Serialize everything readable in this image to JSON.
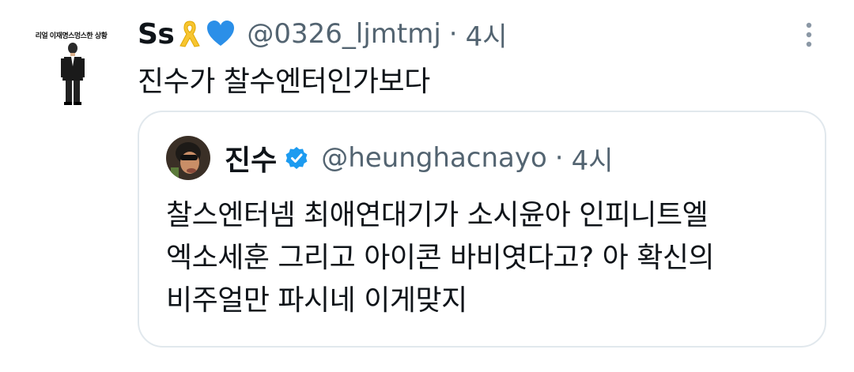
{
  "tweet": {
    "avatar_caption": "리얼 이재명스멍스한 상황",
    "display_name": "Ss",
    "display_emojis": [
      "ribbon-icon",
      "blue-heart-icon"
    ],
    "handle": "@0326_ljmtmj",
    "separator": "·",
    "time": "4시",
    "text": "진수가 찰수엔터인가보다"
  },
  "quote": {
    "display_name": "진수",
    "verified": true,
    "handle": "@heunghacnayo",
    "separator": "·",
    "time": "4시",
    "text_lines": [
      "찰스엔터넴 최애연대기가 소시윤아 인피니트엘",
      "엑소세훈 그리고 아이콘 바비엿다고? 아 확신의",
      "비주얼만 파시네 이게맞지"
    ]
  },
  "colors": {
    "text": "#0f1419",
    "secondary": "#536471",
    "verified_blue": "#1d9bf0",
    "ribbon_yellow": "#f7c531",
    "heart_blue": "#2b8fe8",
    "border": "#e1e8ed"
  }
}
